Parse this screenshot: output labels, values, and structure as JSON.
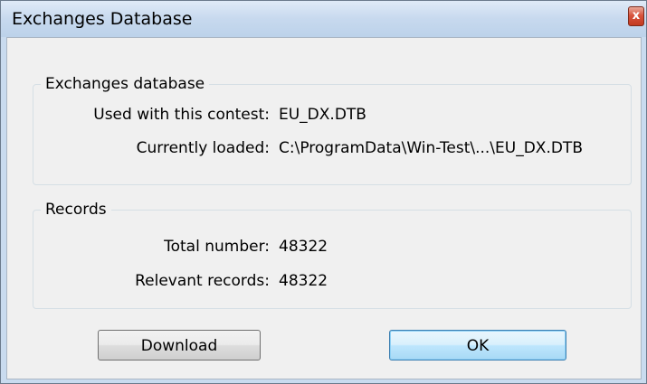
{
  "window": {
    "title": "Exchanges Database",
    "close_symbol": "x"
  },
  "exchanges_group": {
    "title": "Exchanges database",
    "used_label": "Used with this contest:",
    "used_value": "EU_DX.DTB",
    "loaded_label": "Currently loaded:",
    "loaded_value": "C:\\ProgramData\\Win-Test\\...\\EU_DX.DTB"
  },
  "records_group": {
    "title": "Records",
    "total_label": "Total number:",
    "total_value": "48322",
    "relevant_label": "Relevant records:",
    "relevant_value": "48322"
  },
  "buttons": {
    "download_label": "Download",
    "ok_label": "OK"
  },
  "colors": {
    "title_bar": "#c7d9ee",
    "client_bg": "#f0f0f0",
    "close_button": "#c23a20",
    "default_button_border": "#3c7fb1"
  }
}
